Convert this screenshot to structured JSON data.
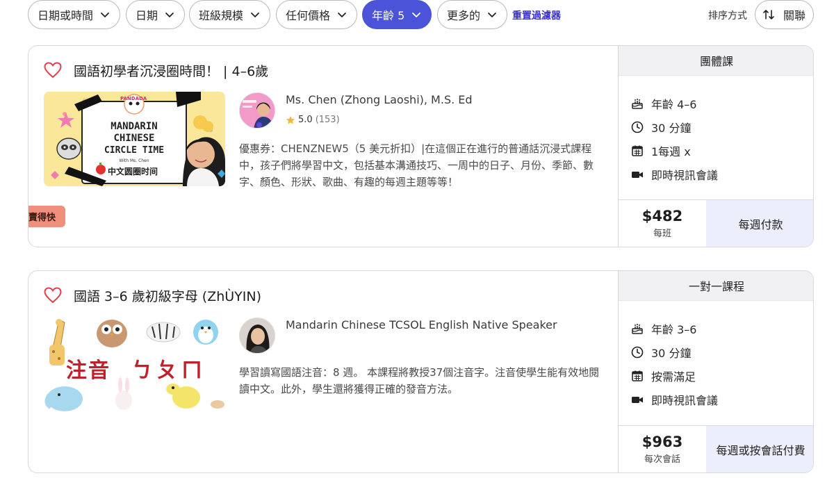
{
  "filters": {
    "items": [
      {
        "label": "日期或時間"
      },
      {
        "label": "日期"
      },
      {
        "label": "班級規模"
      },
      {
        "label": "任何價格"
      },
      {
        "label": "年齡 5"
      },
      {
        "label": "更多的"
      }
    ],
    "active_index": 4,
    "reset_label": "重置過濾器",
    "sort_label": "排序方式",
    "sort_value": "關聯"
  },
  "colors": {
    "accent": "#4b53d8",
    "link": "#3a2fd6",
    "heart": "#e0404a",
    "badge": "#f08f7b",
    "pay_button_bg": "#eceefb"
  },
  "listings": [
    {
      "title": "國語初學者沉浸圈時間！ | 4–6歲",
      "teacher": "Ms. Chen (Zhong Laoshi), M.S. Ed",
      "rating": "5.0",
      "review_count": "(153)",
      "description": "優惠券：CHENZNEW5（5 美元折扣）|在這個正在進行的普通話沉浸式課程中，孩子們將學習中文，包括基本溝通技巧、一周中的日子、月份、季節、數字、顏色、形狀、歌曲、有趣的每週主題等等！",
      "badge": "賣得快",
      "thumb_text": {
        "brand": "PANDADA",
        "line1": "MANDARIN",
        "line2": "CHINESE",
        "line3": "CIRCLE TIME",
        "with": "With Ms. Chen",
        "cn": "中文圆圈时间"
      },
      "class_type": "團體課",
      "facts": {
        "age": "年齡 4–6",
        "duration": "30 分鐘",
        "frequency": "1每週 x",
        "format": "即時視訊會議"
      },
      "price": "$482",
      "price_unit": "每班",
      "pay_label": "每週付款"
    },
    {
      "title": "國語 3–6 歲初級字母 (ZhÙYIN)",
      "teacher": "Mandarin Chinese TCSOL English Native Speaker",
      "description": "學習讀寫國語注音：8 週。 本課程將教授37個注音字。注音使學生能有效地閱讀中文。此外，學生還將獲得正確的發音方法。",
      "thumb_text": {
        "zhuyin": "注音",
        "symbols": "ㄅㄆㄇ"
      },
      "class_type": "一對一課程",
      "facts": {
        "age": "年齡 3–6",
        "duration": "30 分鐘",
        "frequency": "按需滿足",
        "format": "即時視訊會議"
      },
      "price": "$963",
      "price_unit": "每次會話",
      "pay_label": "每週或按會話付費"
    }
  ]
}
